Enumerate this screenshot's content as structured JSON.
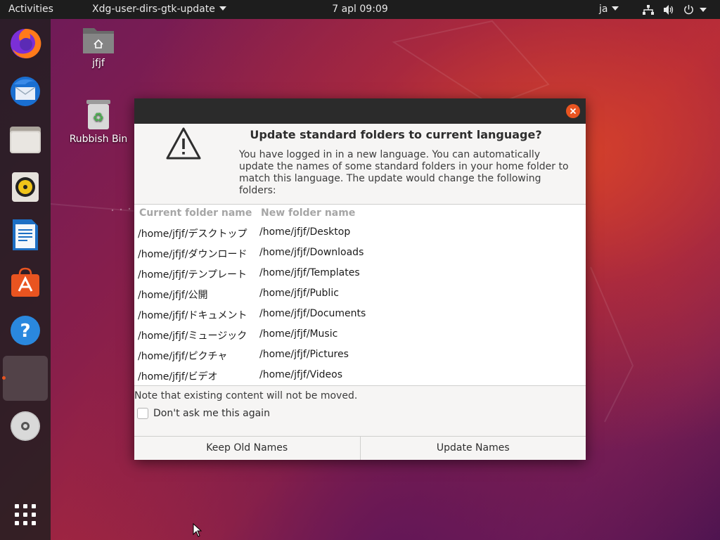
{
  "topbar": {
    "activities": "Activities",
    "app_menu": "Xdg-user-dirs-gtk-update",
    "clock": "7 apl  09:09",
    "language": "ja",
    "tray_icons": [
      "network-icon",
      "volume-icon",
      "power-icon"
    ]
  },
  "dock": {
    "items": [
      "firefox",
      "thunderbird",
      "files",
      "rhythmbox",
      "libreoffice-writer",
      "ubuntu-software",
      "help",
      "running-app",
      "dvd-drive",
      "show-applications"
    ],
    "active_item": "running-app"
  },
  "desktop": {
    "icons": [
      {
        "label": "jfjf",
        "icon": "home-folder-icon"
      },
      {
        "label": "Rubbish Bin",
        "icon": "trash-icon"
      }
    ]
  },
  "dialog": {
    "title": "Update standard folders to current language?",
    "message": "You have logged in in a new language. You can automatically update the names of some standard folders in your home folder to match this language. The update would change the following folders:",
    "columns": [
      "Current folder name",
      "New folder name"
    ],
    "rows": [
      {
        "current": "/home/jfjf/デスクトップ",
        "new": "/home/jfjf/Desktop"
      },
      {
        "current": "/home/jfjf/ダウンロード",
        "new": "/home/jfjf/Downloads"
      },
      {
        "current": "/home/jfjf/テンプレート",
        "new": "/home/jfjf/Templates"
      },
      {
        "current": "/home/jfjf/公開",
        "new": "/home/jfjf/Public"
      },
      {
        "current": "/home/jfjf/ドキュメント",
        "new": "/home/jfjf/Documents"
      },
      {
        "current": "/home/jfjf/ミュージック",
        "new": "/home/jfjf/Music"
      },
      {
        "current": "/home/jfjf/ピクチャ",
        "new": "/home/jfjf/Pictures"
      },
      {
        "current": "/home/jfjf/ビデオ",
        "new": "/home/jfjf/Videos"
      }
    ],
    "note": "Note that existing content will not be moved.",
    "checkbox_label": "Don't ask me this again",
    "checkbox_checked": false,
    "buttons": {
      "keep": "Keep Old Names",
      "update": "Update Names"
    }
  },
  "colors": {
    "accent": "#e95420",
    "topbar": "#1d1d1d",
    "dialog_bg": "#f6f5f4",
    "titlebar": "#2b2b2b"
  }
}
